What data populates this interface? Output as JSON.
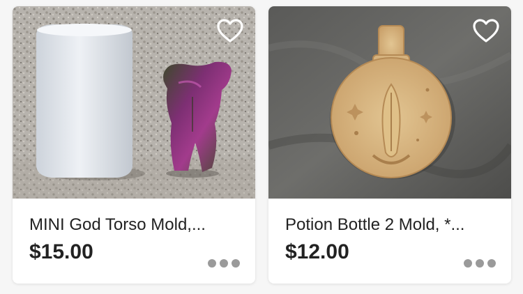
{
  "listings": [
    {
      "title": "MINI God Torso Mold,...",
      "price": "$15.00",
      "favorite_icon": "heart-outline-icon",
      "more_icon": "ellipsis-icon",
      "image": "white candle cylinder and iridescent torso figure on gravel"
    },
    {
      "title": "Potion Bottle 2 Mold, *...",
      "price": "$12.00",
      "favorite_icon": "heart-outline-icon",
      "more_icon": "ellipsis-icon",
      "image": "wooden potion bottle shaped mold on grey fabric"
    }
  ],
  "colors": {
    "background": "#f6f6f6",
    "card": "#ffffff",
    "text": "#222222",
    "dots": "#9a9a9a"
  }
}
